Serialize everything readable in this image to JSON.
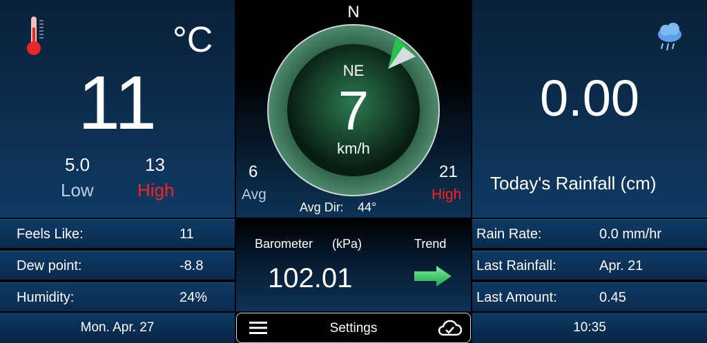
{
  "temperature": {
    "unit": "°C",
    "current": "11",
    "low": "5.0",
    "low_label": "Low",
    "high": "13",
    "high_label": "High"
  },
  "wind": {
    "compass_north": "N",
    "direction": "NE",
    "speed": "7",
    "unit": "km/h",
    "avg": "6",
    "avg_label": "Avg",
    "high": "21",
    "high_label": "High",
    "avg_dir_label": "Avg Dir:",
    "avg_dir_value": "44°"
  },
  "rain": {
    "today_value": "0.00",
    "today_label": "Today's Rainfall (cm)"
  },
  "left_rows": [
    {
      "label": "Feels Like:",
      "value": "11"
    },
    {
      "label": "Dew point:",
      "value": "-8.8"
    },
    {
      "label": "Humidity:",
      "value": "24%"
    }
  ],
  "right_rows": [
    {
      "label": "Rain Rate:",
      "value": "0.0 mm/hr"
    },
    {
      "label": "Last Rainfall:",
      "value": "Apr. 21"
    },
    {
      "label": "Last Amount:",
      "value": "0.45"
    }
  ],
  "barometer": {
    "label": "Barometer",
    "unit": "(kPa)",
    "value": "102.01",
    "trend_label": "Trend"
  },
  "footer": {
    "date": "Mon. Apr. 27",
    "settings_label": "Settings",
    "time": "10:35"
  },
  "colors": {
    "high": "#ff2222",
    "low": "#b9cde6",
    "arrow": "#39d36b"
  },
  "icons": {
    "thermometer": "thermometer-icon",
    "rain_cloud": "rain-cloud-icon",
    "menu": "hamburger-menu-icon",
    "cloud_check": "cloud-check-icon",
    "trend": "arrow-right-icon"
  }
}
